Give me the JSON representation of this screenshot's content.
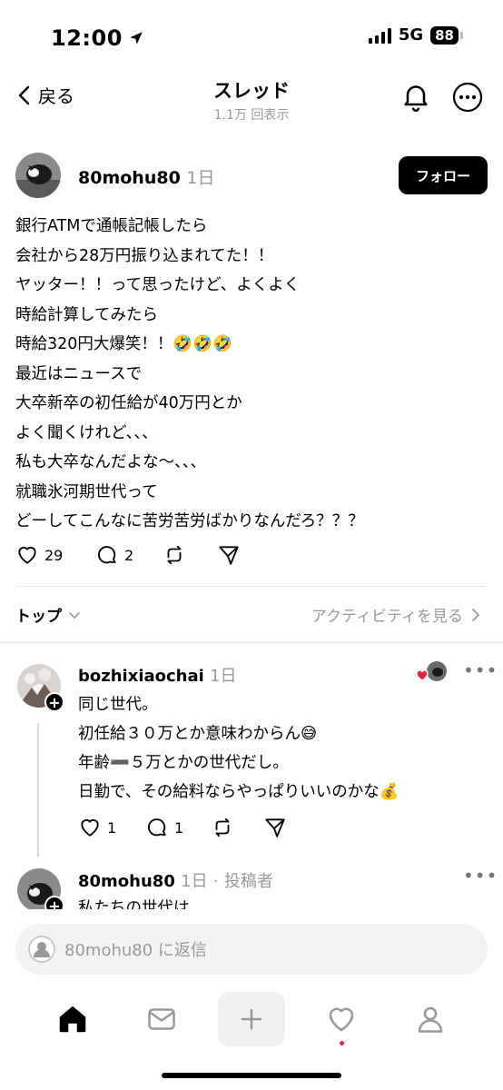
{
  "status": {
    "time": "12:00",
    "network": "5G",
    "battery": "88"
  },
  "header": {
    "back_label": "戻る",
    "title": "スレッド",
    "views": "1.1万 回表示"
  },
  "post": {
    "username": "80mohu80",
    "age": "1日",
    "follow_label": "フォロー",
    "lines": [
      "銀行ATMで通帳記帳したら",
      "会社から28万円振り込まれてた！！",
      "ヤッター！！って思ったけど、よくよく",
      "時給計算してみたら",
      "時給320円大爆笑！！🤣🤣🤣",
      "最近はニュースで",
      "大卒新卒の初任給が40万円とか",
      "よく聞くけれど、、、",
      "私も大卒なんだよな〜、、、",
      "就職氷河期世代って",
      "どーしてこんなに苦労苦労ばかりなんだろ？？？"
    ],
    "likes": "29",
    "replies": "2"
  },
  "sort": {
    "label": "トップ",
    "activity_label": "アクティビティを見る"
  },
  "reply1": {
    "username": "bozhixiaochai",
    "age": "1日",
    "lines": [
      "同じ世代。",
      "初任給３０万とか意味わからん😅",
      "年齢➖５万とかの世代だし。",
      "日勤で、その給料ならやっぱりいいのかな💰"
    ],
    "likes": "1",
    "replies": "1"
  },
  "reply2": {
    "username": "80mohu80",
    "age": "1日",
    "author_tag": "投稿者",
    "partial_text": "私たちの世代は"
  },
  "input": {
    "placeholder": "80mohu80 に返信"
  },
  "icons": [
    "location-arrow-icon",
    "signal-icon",
    "battery-icon",
    "chevron-left-icon",
    "bell-icon",
    "more-circle-icon",
    "heart-icon",
    "comment-icon",
    "repost-icon",
    "share-icon",
    "chevron-down-icon",
    "chevron-right-icon",
    "more-dots-icon",
    "home-icon",
    "inbox-icon",
    "plus-icon",
    "activity-heart-icon",
    "profile-icon"
  ],
  "colors": {
    "accent": "#000000",
    "muted": "#999999",
    "like_red": "#e6223c"
  }
}
